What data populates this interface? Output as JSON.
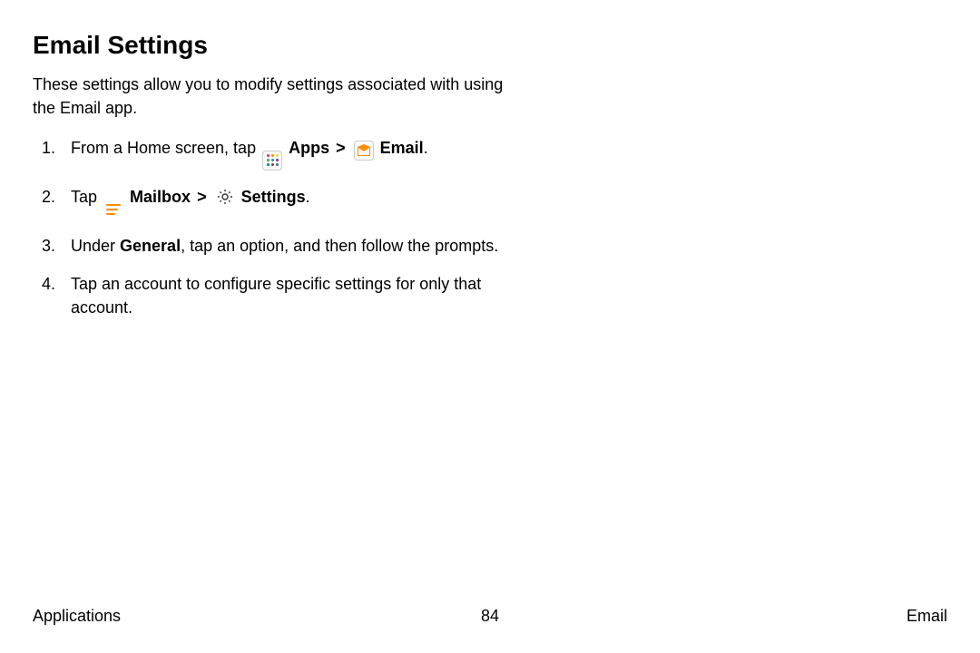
{
  "title": "Email Settings",
  "intro": "These settings allow you to modify settings associated with using the Email app.",
  "step1": {
    "pre": "From a Home screen, tap ",
    "apps": "Apps",
    "email": "Email",
    "period": "."
  },
  "step2": {
    "pre": "Tap ",
    "mailbox": "Mailbox",
    "settings": "Settings",
    "period": "."
  },
  "step3": {
    "pre": "Under ",
    "general": "General",
    "rest": ", tap an option, and then follow the prompts."
  },
  "step4": "Tap an account to configure specific settings for only that account.",
  "chevron": ">",
  "footer": {
    "left": "Applications",
    "center": "84",
    "right": "Email"
  }
}
